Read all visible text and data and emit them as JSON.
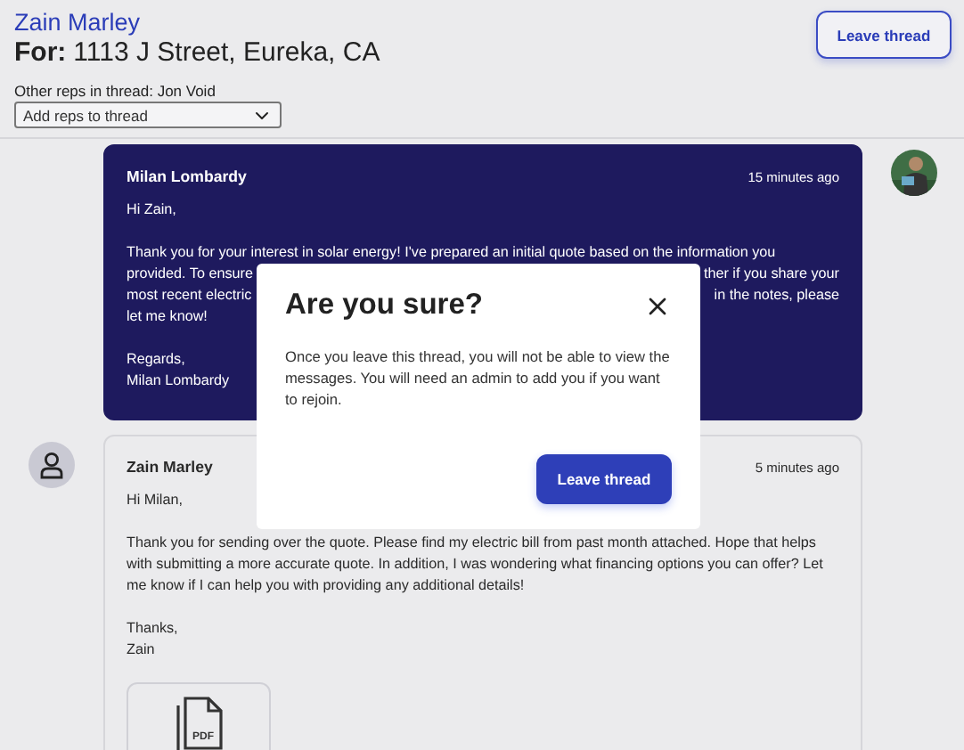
{
  "header": {
    "name": "Zain Marley",
    "for_label": "For:",
    "address": "1113 J Street, Eureka, CA",
    "other_reps": "Other reps in thread: Jon Void",
    "add_reps": {
      "value": "Add reps to thread"
    },
    "leave_button": "Leave thread"
  },
  "messages": [
    {
      "kind": "sent",
      "sender": "Milan Lombardy",
      "time": "15 minutes ago",
      "paragraphs": [
        {
          "lines": [
            {
              "left": "Hi Zain,"
            }
          ]
        },
        {
          "lines": [
            {
              "left": "Thank you for your interest in solar energy! I've prepared an initial quote based on the information you"
            },
            {
              "left": "provided. To ensure",
              "right": "ther if you share your"
            },
            {
              "left": "most recent electric",
              "right": "in the notes, please"
            },
            {
              "left": "let me know!"
            }
          ]
        },
        {
          "lines": [
            {
              "left": "Regards,"
            },
            {
              "left": "Milan Lombardy"
            }
          ]
        }
      ]
    },
    {
      "kind": "received",
      "sender": "Zain Marley",
      "time": "5 minutes ago",
      "paragraphs": [
        {
          "lines": [
            {
              "left": "Hi Milan,"
            }
          ]
        },
        {
          "lines": [
            {
              "left": "Thank you for sending over the quote. Please find my electric bill from past month attached. Hope that helps with submitting a more accurate quote. In addition, I was wondering what financing options you can offer? Let me know if I can help you with providing any additional details!"
            }
          ]
        },
        {
          "lines": [
            {
              "left": "Thanks,"
            },
            {
              "left": "Zain"
            }
          ]
        }
      ],
      "attachment": {
        "label": "PDF"
      }
    }
  ],
  "dialog": {
    "title": "Are you sure?",
    "text": "Once you leave this thread, you will not be able to view the messages. You will need an admin to add you if you want to rejoin.",
    "button": "Leave thread"
  }
}
